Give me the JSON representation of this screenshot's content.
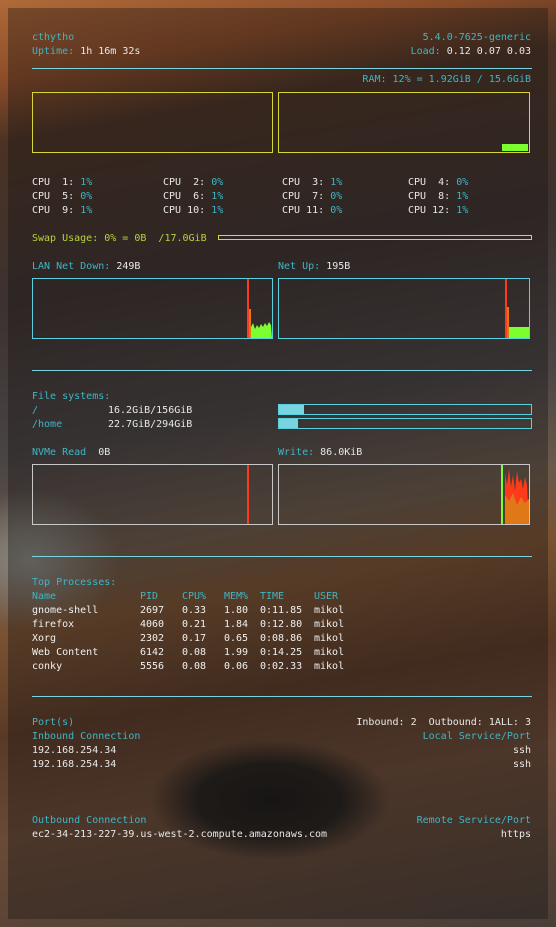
{
  "header": {
    "user": "cthytho",
    "uptime_label": "Uptime:",
    "uptime_value": "1h 16m 32s",
    "kernel": "5.4.0-7625-generic",
    "load_label": "Load:",
    "load_value": "0.12 0.07 0.03"
  },
  "ram": {
    "text": "RAM: 12% = 1.92GiB / 15.6GiB",
    "fraction": 0.12
  },
  "cpus": [
    {
      "label": "CPU  1:",
      "value": "1%"
    },
    {
      "label": "CPU  2:",
      "value": "0%"
    },
    {
      "label": "CPU  3:",
      "value": "1%"
    },
    {
      "label": "CPU  4:",
      "value": "0%"
    },
    {
      "label": "CPU  5:",
      "value": "0%"
    },
    {
      "label": "CPU  6:",
      "value": "1%"
    },
    {
      "label": "CPU  7:",
      "value": "0%"
    },
    {
      "label": "CPU  8:",
      "value": "1%"
    },
    {
      "label": "CPU  9:",
      "value": "1%"
    },
    {
      "label": "CPU 10:",
      "value": "1%"
    },
    {
      "label": "CPU 11:",
      "value": "0%"
    },
    {
      "label": "CPU 12:",
      "value": "1%"
    }
  ],
  "swap": {
    "text": "Swap Usage: 0% = 0B  /17.0GiB",
    "fraction": 0
  },
  "net": {
    "down_label": "LAN Net Down:",
    "down_value": "249B",
    "up_label": "Net Up:",
    "up_value": "195B"
  },
  "filesystems": {
    "title": "File systems:",
    "items": [
      {
        "mount": "/",
        "usage": "16.2GiB/156GiB",
        "fraction": 0.1
      },
      {
        "mount": "/home",
        "usage": "22.7GiB/294GiB",
        "fraction": 0.077
      }
    ]
  },
  "disk": {
    "read_label": "NVMe Read",
    "read_value": "0B",
    "write_label": "Write:",
    "write_value": "86.0KiB"
  },
  "processes": {
    "title": "Top Processes:",
    "headers": [
      "Name",
      "PID",
      "CPU%",
      "MEM%",
      "TIME",
      "USER"
    ],
    "rows": [
      [
        "gnome-shell",
        "2697",
        "0.33",
        "1.80",
        "0:11.85",
        "mikol"
      ],
      [
        "firefox",
        "4060",
        "0.21",
        "1.84",
        "0:12.80",
        "mikol"
      ],
      [
        "Xorg",
        "2302",
        "0.17",
        "0.65",
        "0:08.86",
        "mikol"
      ],
      [
        "Web Content",
        "6142",
        "0.08",
        "1.99",
        "0:14.25",
        "mikol"
      ],
      [
        "conky",
        "5556",
        "0.08",
        "0.06",
        "0:02.33",
        "mikol"
      ]
    ]
  },
  "ports": {
    "title": "Port(s)",
    "summary": "Inbound: 2  Outbound: 1ALL: 3",
    "inbound_label": "Inbound Connection",
    "local_label": "Local Service/Port",
    "inbound": [
      {
        "ip": "192.168.254.34",
        "service": "ssh"
      },
      {
        "ip": "192.168.254.34",
        "service": "ssh"
      }
    ],
    "outbound_label": "Outbound Connection",
    "remote_label": "Remote Service/Port",
    "outbound": [
      {
        "host": "ec2-34-213-227-39.us-west-2.compute.amazonaws.com",
        "service": "https"
      }
    ]
  },
  "colors": {
    "label": "#3fb6c6",
    "graph_border": "#59d0e0",
    "ram_border": "#d6d63a",
    "graph_green": "#7cff2e",
    "graph_red": "#ff3a1a",
    "graph_orange": "#e07818"
  }
}
